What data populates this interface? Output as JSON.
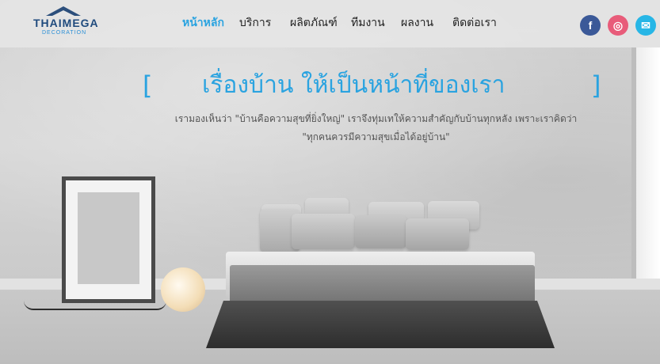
{
  "header": {
    "logo": {
      "name": "THAIMEGA",
      "sub": "DECORATION"
    },
    "nav": [
      {
        "label": "หน้าหลัก",
        "active": true
      },
      {
        "label": "บริการ",
        "active": false
      },
      {
        "label": "ผลิตภัณฑ์",
        "active": false
      },
      {
        "label": "ทีมงาน",
        "active": false
      },
      {
        "label": "ผลงาน",
        "active": false
      },
      {
        "label": "ติดต่อเรา",
        "active": false
      }
    ],
    "social": [
      {
        "icon": "facebook-icon",
        "glyph": "f",
        "color": "#3b5998"
      },
      {
        "icon": "instagram-icon",
        "glyph": "◎",
        "color": "#e85c7a"
      },
      {
        "icon": "mail-icon",
        "glyph": "✉",
        "color": "#27b6e6"
      }
    ]
  },
  "hero": {
    "bracket_open": "[",
    "bracket_close": "]",
    "headline": "เรื่องบ้าน   ให้เป็นหน้าที่ของเรา",
    "tagline_1": "เรามองเห็นว่า \"บ้านคือความสุขที่ยิ่งใหญ่\" เราจึงทุ่มเทให้ความสำคัญกับบ้านทุกหลัง เพราะเราคิดว่า",
    "tagline_2": "\"ทุกคนควรมีความสุขเมื่อได้อยู่บ้าน\"",
    "accent_color": "#2aa3e0"
  }
}
